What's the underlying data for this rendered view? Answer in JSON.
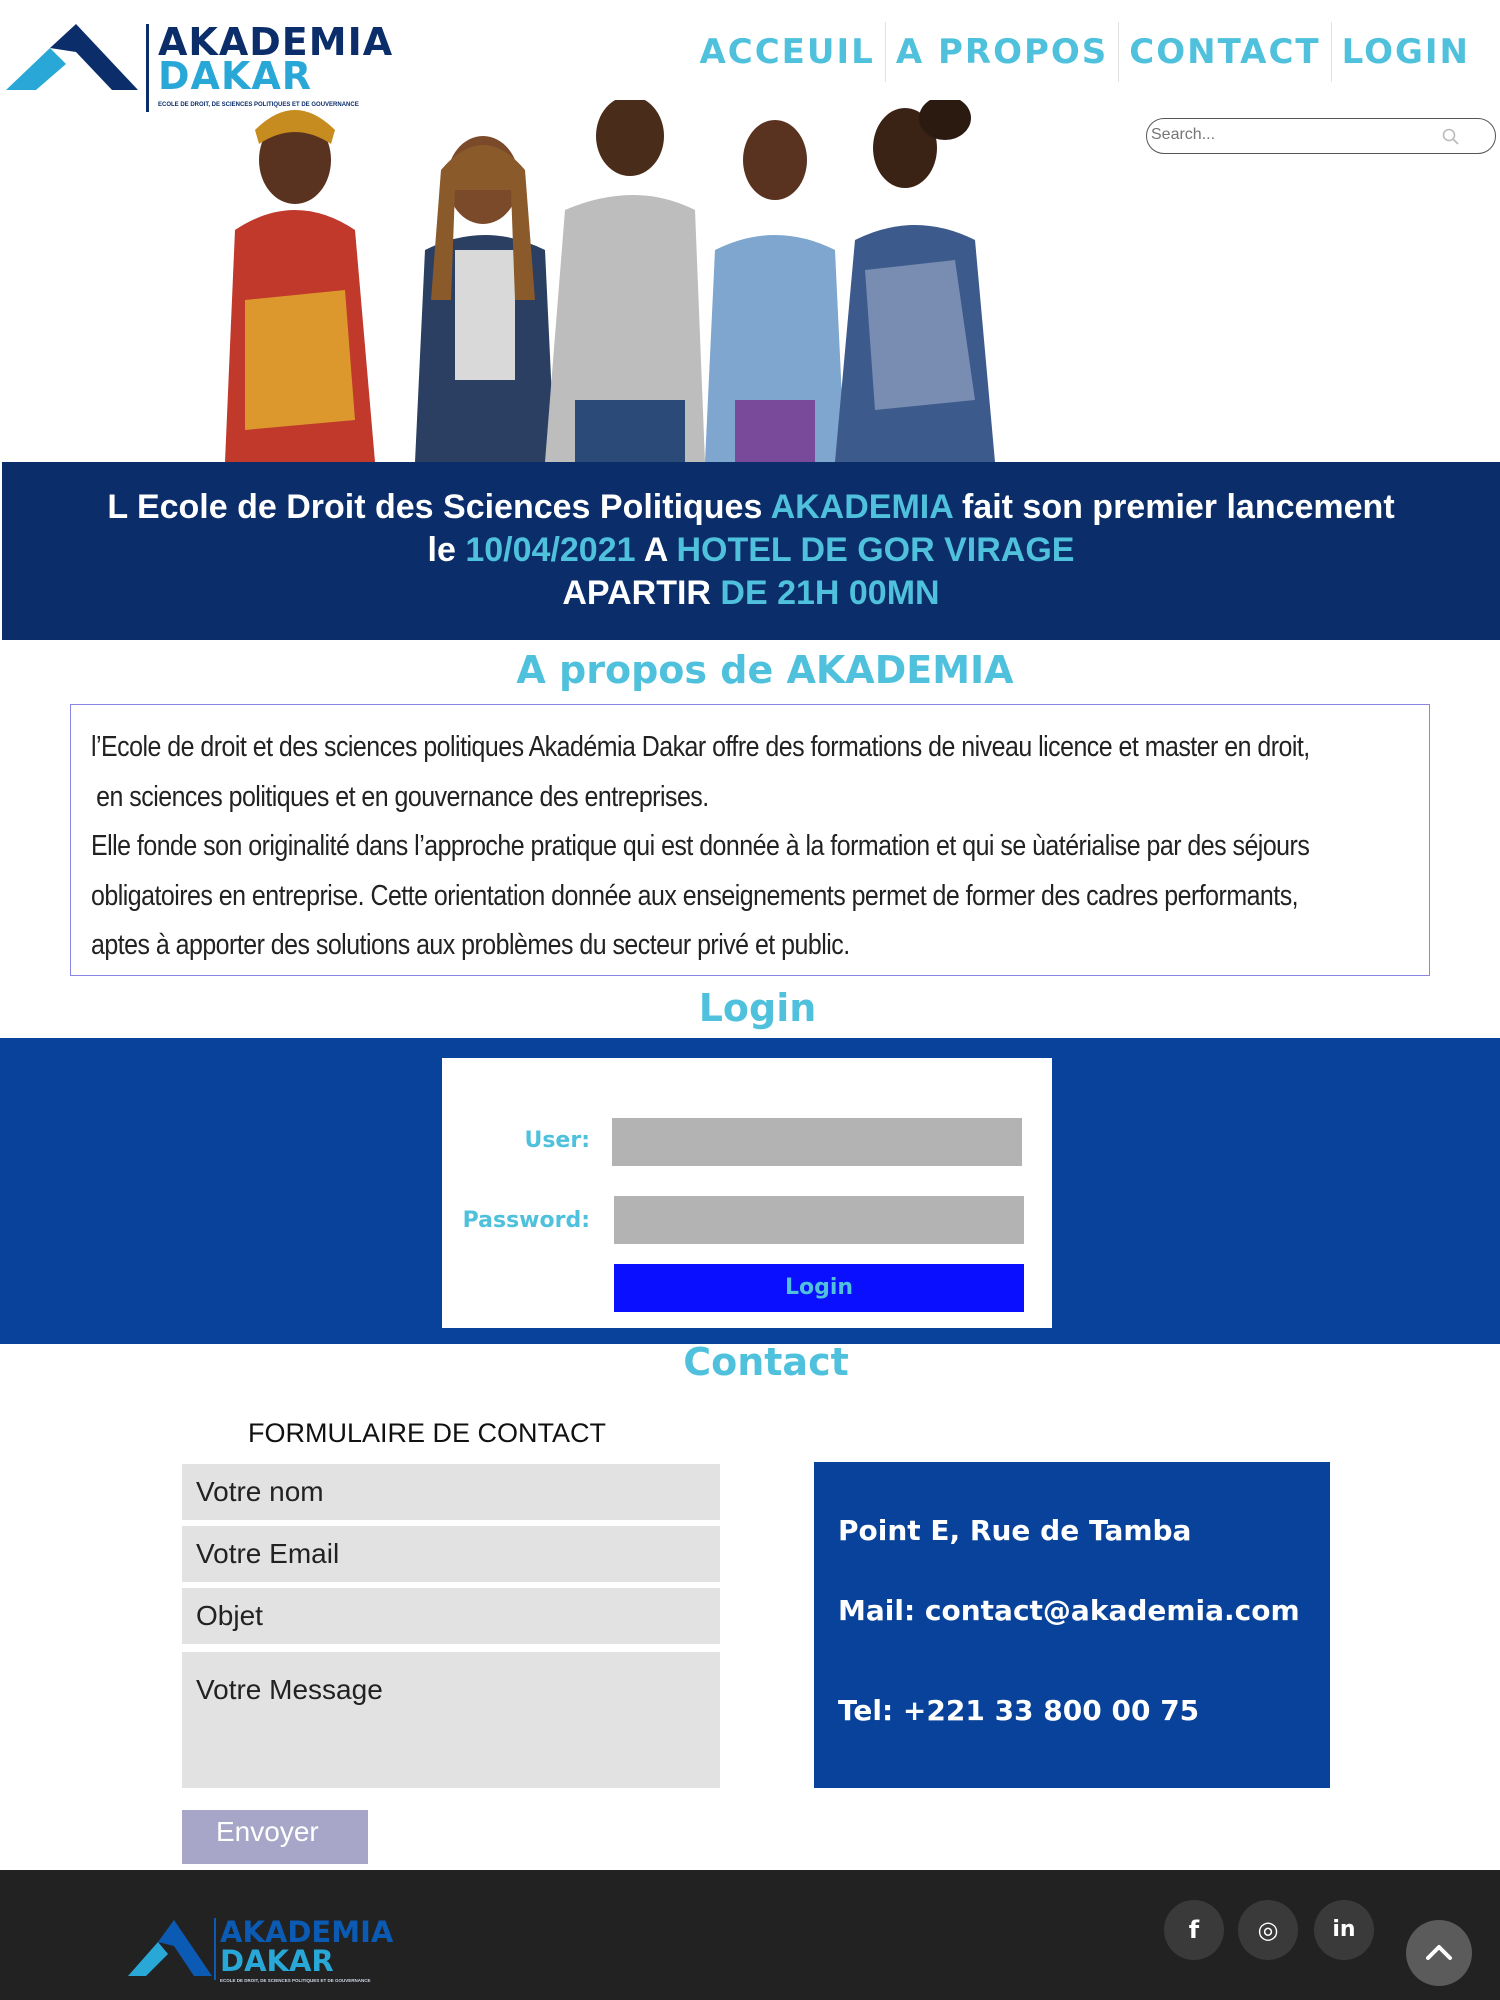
{
  "header": {
    "brand_line1": "AKADEMIA",
    "brand_line2": "DAKAR",
    "brand_tagline": "ECOLE DE DROIT, DE SCIENCES POLITIQUES ET DE GOUVERNANCE",
    "nav": [
      "ACCEUIL",
      "A PROPOS",
      "CONTACT",
      "LOGIN"
    ],
    "search_placeholder": "Search...",
    "search_icon": "search-icon"
  },
  "banner": {
    "line1_a": "L Ecole de Droit des Sciences Politiques ",
    "line1_b": "AKADEMIA",
    "line1_c": " fait son premier lancement",
    "line2_a": "le ",
    "line2_b": "10/04/2021",
    "line2_c": " A ",
    "line2_d": "HOTEL DE GOR VIRAGE",
    "line3_a": "APARTIR ",
    "line3_b": "DE 21H 00MN"
  },
  "about": {
    "title": "A propos de AKADEMIA",
    "lines": [
      "l’Ecole de droit et des sciences politiques Akadémia Dakar offre des formations de niveau licence et master en droit,",
      " en sciences politiques et en gouvernance des entreprises.",
      "Elle fonde son originalité dans l’approche pratique qui est donnée à la formation et qui se ùatérialise par des séjours",
      "obligatoires en entreprise. Cette orientation donnée aux enseignements permet de former des cadres performants,",
      "aptes à apporter des solutions aux problèmes du secteur privé et public."
    ]
  },
  "login": {
    "title": "Login",
    "user_label": "User:",
    "password_label": "Password:",
    "button": "Login"
  },
  "contact": {
    "title": "Contact",
    "form_title": "FORMULAIRE DE CONTACT",
    "name_placeholder": "Votre nom",
    "email_placeholder": "Votre Email",
    "subject_placeholder": "Objet",
    "message_placeholder": "Votre Message",
    "send_button": "Envoyer",
    "address": "Point E, Rue de Tamba",
    "mail": "Mail: contact@akademia.com",
    "tel": "Tel: +221 33 800 00 75"
  },
  "footer": {
    "brand_line1": "AKADEMIA",
    "brand_line2": "DAKAR",
    "brand_tagline": "ECOLE DE DROIT, DE SCIENCES POLITIQUES ET DE GOUVERNANCE",
    "social": [
      "facebook-icon",
      "instagram-icon",
      "linkedin-icon"
    ],
    "social_glyphs": [
      "f",
      "◎",
      "in"
    ],
    "back_to_top_icon": "chevron-up-icon"
  },
  "colors": {
    "accent": "#4fc1dc",
    "navy": "#0b2e6b",
    "blue": "#08429a",
    "button_blue": "#0a10ff",
    "footer": "#222222"
  }
}
